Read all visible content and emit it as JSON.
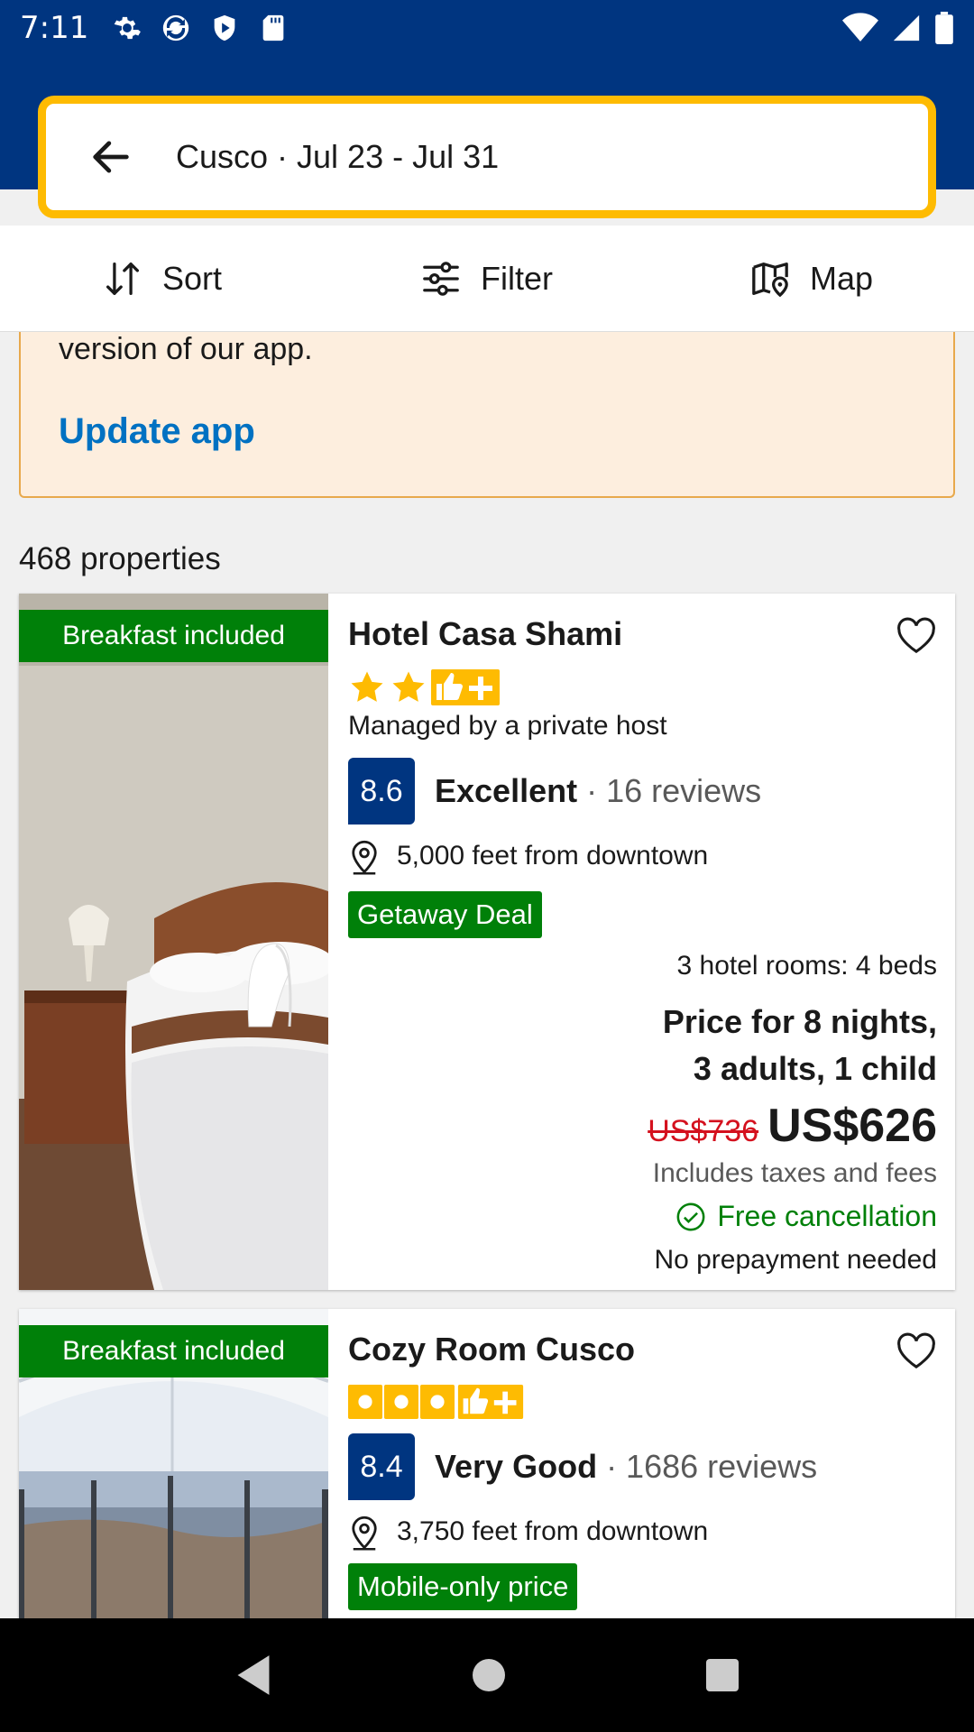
{
  "status": {
    "time": "7:11"
  },
  "search": {
    "text": "Cusco · Jul 23 - Jul 31"
  },
  "toolbar": {
    "sort": "Sort",
    "filter": "Filter",
    "map": "Map"
  },
  "banner": {
    "text": "version of our app.",
    "link": "Update app"
  },
  "results": {
    "count": "468 properties"
  },
  "cards": [
    {
      "badge": "Breakfast included",
      "name": "Hotel Casa Shami",
      "stars": 2,
      "host": "Managed by a private host",
      "score": "8.6",
      "rating_word": "Excellent",
      "reviews": " · 16 reviews",
      "distance": "5,000 feet from downtown",
      "deal": "Getaway Deal",
      "rooms": "3 hotel rooms: 4 beds",
      "price_for_1": "Price for 8 nights,",
      "price_for_2": "3 adults, 1 child",
      "old_price": "US$736",
      "price": "US$626",
      "taxes": "Includes taxes and fees",
      "cancel": "Free cancellation",
      "prepay": "No prepayment needed"
    },
    {
      "badge": "Breakfast included",
      "name": "Cozy Room Cusco",
      "stars": 3,
      "score": "8.4",
      "rating_word": "Very Good",
      "reviews": " · 1686 reviews",
      "distance": "3,750 feet from downtown",
      "deal": "Mobile-only price"
    }
  ],
  "colors": {
    "brand": "#003580",
    "accent": "#febb02",
    "green": "#008009",
    "link": "#0071c2",
    "price_red": "#d4111e"
  }
}
